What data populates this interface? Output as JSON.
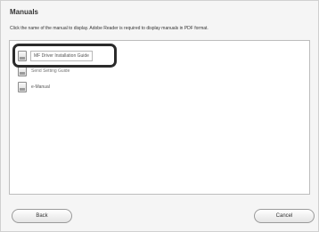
{
  "dialog": {
    "title": "Manuals",
    "description": "Click the name of the manual to display. Adobe Reader is required to display manuals in PDF format."
  },
  "manuals": [
    {
      "label": "MF Driver Installation Guide",
      "icon": "document-icon"
    },
    {
      "label": "Send Setting Guide",
      "icon": "document-icon"
    },
    {
      "label": "e-Manual",
      "icon": "document-icon"
    }
  ],
  "buttons": {
    "back": "Back",
    "cancel": "Cancel"
  },
  "colors": {
    "panel_background": "#ffffff",
    "window_background": "#f5f5f5",
    "highlight_frame": "#2b2b2b"
  }
}
